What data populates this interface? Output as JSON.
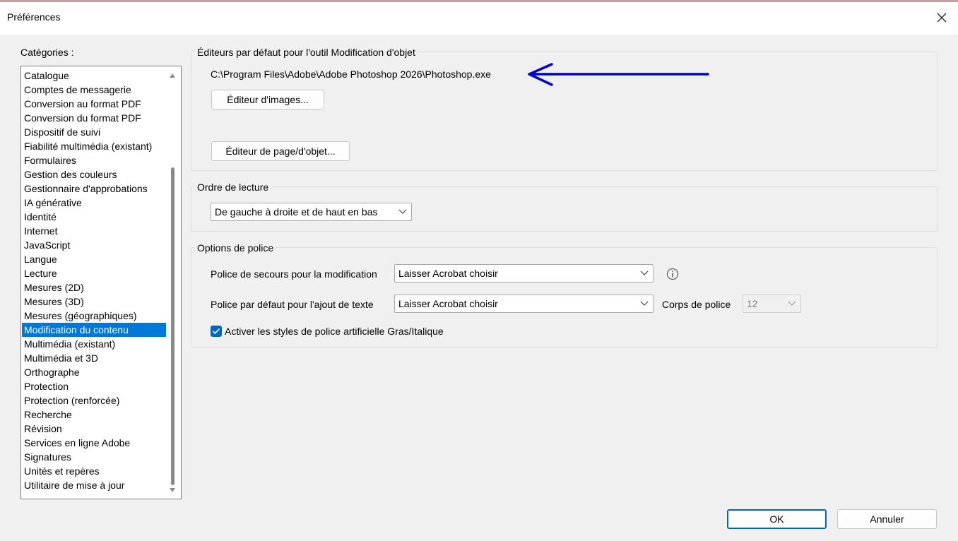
{
  "window": {
    "title": "Préférences"
  },
  "categories": {
    "label": "Catégories :",
    "items": [
      "Catalogue",
      "Comptes de messagerie",
      "Conversion au format PDF",
      "Conversion du format PDF",
      "Dispositif de suivi",
      "Fiabilité multimédia (existant)",
      "Formulaires",
      "Gestion des couleurs",
      "Gestionnaire d'approbations",
      "IA générative",
      "Identité",
      "Internet",
      "JavaScript",
      "Langue",
      "Lecture",
      "Mesures (2D)",
      "Mesures (3D)",
      "Mesures (géographiques)",
      "Modification du contenu",
      "Multimédia (existant)",
      "Multimédia et 3D",
      "Orthographe",
      "Protection",
      "Protection (renforcée)",
      "Recherche",
      "Révision",
      "Services en ligne Adobe",
      "Signatures",
      "Unités et repères",
      "Utilitaire de mise à jour"
    ],
    "selected": "Modification du contenu"
  },
  "editors": {
    "title": "Éditeurs par défaut pour l'outil Modification d'objet",
    "image_editor_path": "C:\\Program Files\\Adobe\\Adobe Photoshop 2026\\Photoshop.exe",
    "image_editor_button": "Éditeur d'images...",
    "page_editor_button": "Éditeur de page/d'objet...",
    "annotation_arrow_color": "#0000cc"
  },
  "reading_order": {
    "title": "Ordre de lecture",
    "selected": "De gauche à droite et de haut en bas"
  },
  "font_options": {
    "title": "Options de police",
    "fallback_label": "Police de secours pour la modification",
    "fallback_value": "Laisser Acrobat choisir",
    "default_label": "Police par défaut pour l'ajout de texte",
    "default_value": "Laisser Acrobat choisir",
    "size_label": "Corps de police",
    "size_value": "12",
    "faux_styles_label": "Activer les styles de police artificielle Gras/Italique",
    "faux_styles_checked": true
  },
  "footer": {
    "ok": "OK",
    "cancel": "Annuler"
  }
}
